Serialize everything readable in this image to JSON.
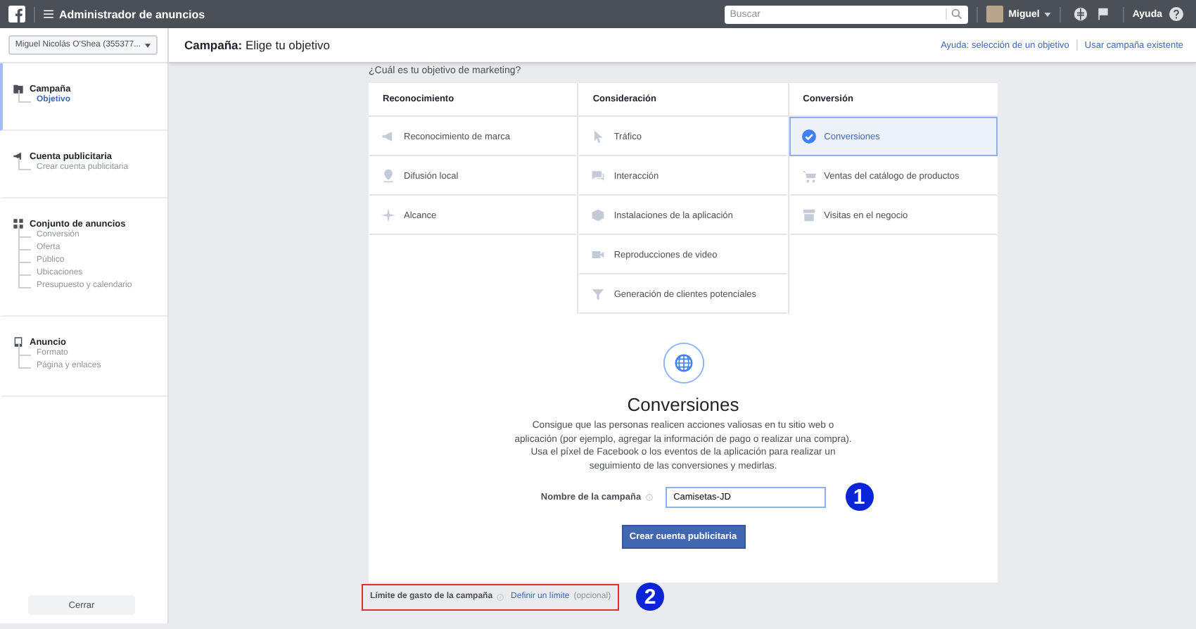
{
  "topbar": {
    "title": "Administrador de anuncios",
    "search": {
      "placeholder": "Buscar"
    },
    "user": "Miguel",
    "help": "Ayuda"
  },
  "sidebar": {
    "account": "Miguel Nicolás O'Shea (355377...",
    "sections": [
      {
        "title": "Campaña",
        "selected": true,
        "items": [
          {
            "label": "Objetivo",
            "selected": true
          }
        ]
      },
      {
        "title": "Cuenta publicitaria",
        "selected": false,
        "items": [
          {
            "label": "Crear cuenta publicitaria",
            "selected": false
          }
        ]
      },
      {
        "title": "Conjunto de anuncios",
        "selected": false,
        "items": [
          {
            "label": "Conversión",
            "selected": false
          },
          {
            "label": "Oferta",
            "selected": false
          },
          {
            "label": "Público",
            "selected": false
          },
          {
            "label": "Ubicaciones",
            "selected": false
          },
          {
            "label": "Presupuesto y calendario",
            "selected": false
          }
        ]
      },
      {
        "title": "Anuncio",
        "selected": false,
        "items": [
          {
            "label": "Formato",
            "selected": false
          },
          {
            "label": "Página y enlaces",
            "selected": false
          }
        ]
      }
    ],
    "close_button": "Cerrar"
  },
  "header": {
    "title": "**Campaña:** Elige tu objetivo",
    "links": [
      "Ayuda: selección de un objetivo",
      "Usar campaña existente"
    ]
  },
  "question": "¿Cuál es tu objetivo de marketing?",
  "objectives": [
    {
      "heading": "Reconocimiento",
      "items": [
        {
          "label": "Reconocimiento de marca",
          "selected": false
        },
        {
          "label": "Difusión local",
          "selected": false
        },
        {
          "label": "Alcance",
          "selected": false
        }
      ]
    },
    {
      "heading": "Consideración",
      "items": [
        {
          "label": "Tráfico",
          "selected": false
        },
        {
          "label": "Interacción",
          "selected": false
        },
        {
          "label": "Instalaciones de la aplicación",
          "selected": false
        },
        {
          "label": "Reproducciones de video",
          "selected": false
        },
        {
          "label": "Generación de clientes potenciales",
          "selected": false
        }
      ]
    },
    {
      "heading": "Conversión",
      "items": [
        {
          "label": "Conversiones",
          "selected": true
        },
        {
          "label": "Ventas del catálogo de productos",
          "selected": false
        },
        {
          "label": "Visitas en el negocio",
          "selected": false
        }
      ]
    }
  ],
  "detail": {
    "title": "Conversiones",
    "description": "Consigue que las personas realicen acciones valiosas en tu sitio web o aplicación (por ejemplo, agregar la información de pago o realizar una compra). Usa el píxel de Facebook o los eventos de la aplicación para realizar un seguimiento de las conversiones y medirlas.",
    "name_label": "Nombre de la campaña",
    "name_value": "Camisetas-JD",
    "button": "Crear cuenta publicitaria"
  },
  "spend_limit": {
    "label": "Límite de gasto de la campaña",
    "link": "Definir un límite",
    "note": "(opcional)"
  },
  "annotations": [
    "1",
    "2"
  ]
}
